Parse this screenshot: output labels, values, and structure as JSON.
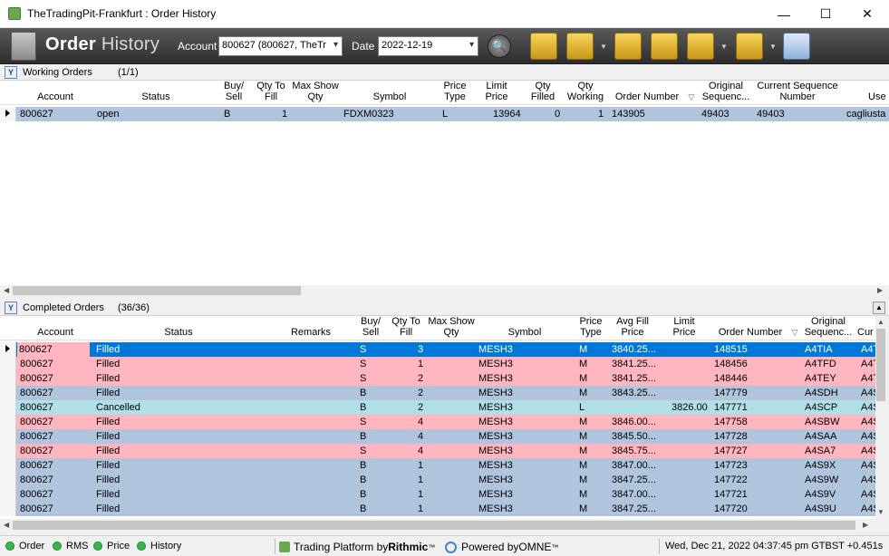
{
  "window": {
    "title": "TheTradingPit-Frankfurt : Order History",
    "minimize": "—",
    "maximize": "☐",
    "close": "✕"
  },
  "toolbar": {
    "logo_bold": "Order",
    "logo_light": " History",
    "account_label": "Account",
    "account_value": "800627 (800627, TheTr",
    "date_label": "Date",
    "date_value": "2022-12-19",
    "search_icon": "🔍",
    "icons": [
      "order-add-icon",
      "gear-settings-icon",
      "money-gears-icon",
      "folder-icon",
      "text-t-icon",
      "clipboard-a-icon",
      "book-icon"
    ]
  },
  "working": {
    "title": "Working Orders",
    "count": "(1/1)",
    "columns": {
      "account": "Account",
      "status": "Status",
      "buy_sell": "Buy/ Sell",
      "qty_to_fill": "Qty To Fill",
      "max_show": "Max Show Qty",
      "symbol": "Symbol",
      "price_type": "Price Type",
      "limit_price": "Limit Price",
      "qty_filled": "Qty Filled",
      "qty_working": "Qty Working",
      "order_number": "Order Number",
      "orig_seq": "Original Sequenc...",
      "curr_seq": "Current Sequence Number",
      "user": "Use"
    },
    "rows": [
      {
        "account": "800627",
        "status": "open",
        "buy_sell": "B",
        "qty_to_fill": "1",
        "max_show": "",
        "symbol": "FDXM0323",
        "price_type": "L",
        "limit_price": "13964",
        "qty_filled": "0",
        "qty_working": "1",
        "order_number": "143905",
        "orig_seq": "49403",
        "curr_seq": "49403",
        "user": "cagliusta"
      }
    ]
  },
  "completed": {
    "title": "Completed Orders",
    "count": "(36/36)",
    "columns": {
      "account": "Account",
      "status": "Status",
      "remarks": "Remarks",
      "buy_sell": "Buy/ Sell",
      "qty_to_fill": "Qty To Fill",
      "max_show": "Max Show Qty",
      "symbol": "Symbol",
      "price_type": "Price Type",
      "avg_fill": "Avg Fill Price",
      "limit_price": "Limit Price",
      "order_number": "Order Number",
      "orig_seq": "Original Sequenc...",
      "cur": "Cur"
    },
    "rows": [
      {
        "account": "800627",
        "status": "Filled",
        "side": "S",
        "qty": "3",
        "symbol": "MESH3",
        "ptype": "M",
        "avg": "3840.25...",
        "limit": "",
        "order": "148515",
        "seq": "A4TIA",
        "cur": "A4T",
        "color": "selected"
      },
      {
        "account": "800627",
        "status": "Filled",
        "side": "S",
        "qty": "1",
        "symbol": "MESH3",
        "ptype": "M",
        "avg": "3841.25...",
        "limit": "",
        "order": "148456",
        "seq": "A4TFD",
        "cur": "A4T",
        "color": "sell"
      },
      {
        "account": "800627",
        "status": "Filled",
        "side": "S",
        "qty": "2",
        "symbol": "MESH3",
        "ptype": "M",
        "avg": "3841.25...",
        "limit": "",
        "order": "148446",
        "seq": "A4TEY",
        "cur": "A4T",
        "color": "sell"
      },
      {
        "account": "800627",
        "status": "Filled",
        "side": "B",
        "qty": "2",
        "symbol": "MESH3",
        "ptype": "M",
        "avg": "3843.25...",
        "limit": "",
        "order": "147779",
        "seq": "A4SDH",
        "cur": "A4S",
        "color": "buy"
      },
      {
        "account": "800627",
        "status": "Cancelled",
        "side": "B",
        "qty": "2",
        "symbol": "MESH3",
        "ptype": "L",
        "avg": "",
        "limit": "3826.00",
        "order": "147771",
        "seq": "A4SCP",
        "cur": "A4S",
        "color": "cancel"
      },
      {
        "account": "800627",
        "status": "Filled",
        "side": "S",
        "qty": "4",
        "symbol": "MESH3",
        "ptype": "M",
        "avg": "3846.00...",
        "limit": "",
        "order": "147758",
        "seq": "A4SBW",
        "cur": "A4S",
        "color": "sell"
      },
      {
        "account": "800627",
        "status": "Filled",
        "side": "B",
        "qty": "4",
        "symbol": "MESH3",
        "ptype": "M",
        "avg": "3845.50...",
        "limit": "",
        "order": "147728",
        "seq": "A4SAA",
        "cur": "A4S",
        "color": "buy"
      },
      {
        "account": "800627",
        "status": "Filled",
        "side": "S",
        "qty": "4",
        "symbol": "MESH3",
        "ptype": "M",
        "avg": "3845.75...",
        "limit": "",
        "order": "147727",
        "seq": "A4SA7",
        "cur": "A4S",
        "color": "sell"
      },
      {
        "account": "800627",
        "status": "Filled",
        "side": "B",
        "qty": "1",
        "symbol": "MESH3",
        "ptype": "M",
        "avg": "3847.00...",
        "limit": "",
        "order": "147723",
        "seq": "A4S9X",
        "cur": "A4S",
        "color": "buy"
      },
      {
        "account": "800627",
        "status": "Filled",
        "side": "B",
        "qty": "1",
        "symbol": "MESH3",
        "ptype": "M",
        "avg": "3847.25...",
        "limit": "",
        "order": "147722",
        "seq": "A4S9W",
        "cur": "A4S",
        "color": "buy"
      },
      {
        "account": "800627",
        "status": "Filled",
        "side": "B",
        "qty": "1",
        "symbol": "MESH3",
        "ptype": "M",
        "avg": "3847.00...",
        "limit": "",
        "order": "147721",
        "seq": "A4S9V",
        "cur": "A4S",
        "color": "buy"
      },
      {
        "account": "800627",
        "status": "Filled",
        "side": "B",
        "qty": "1",
        "symbol": "MESH3",
        "ptype": "M",
        "avg": "3847.25...",
        "limit": "",
        "order": "147720",
        "seq": "A4S9U",
        "cur": "A4S",
        "color": "buy"
      }
    ]
  },
  "row_colors": {
    "selected": "#0078d7",
    "sell": "#ffb6c1",
    "buy": "#b0c4de",
    "cancel": "#b0e0e6",
    "working": "#b0c4de"
  },
  "statusbar": {
    "items": [
      "Order",
      "RMS",
      "Price",
      "History"
    ],
    "platform_prefix": "Trading Platform by ",
    "platform_brand": "Rithmic",
    "platform_tm": "™",
    "powered_prefix": "Powered by ",
    "powered_brand": "OMNE",
    "powered_tm": "™",
    "clock": "Wed, Dec 21, 2022 04:37:45 pm GTBST +0.451s"
  }
}
